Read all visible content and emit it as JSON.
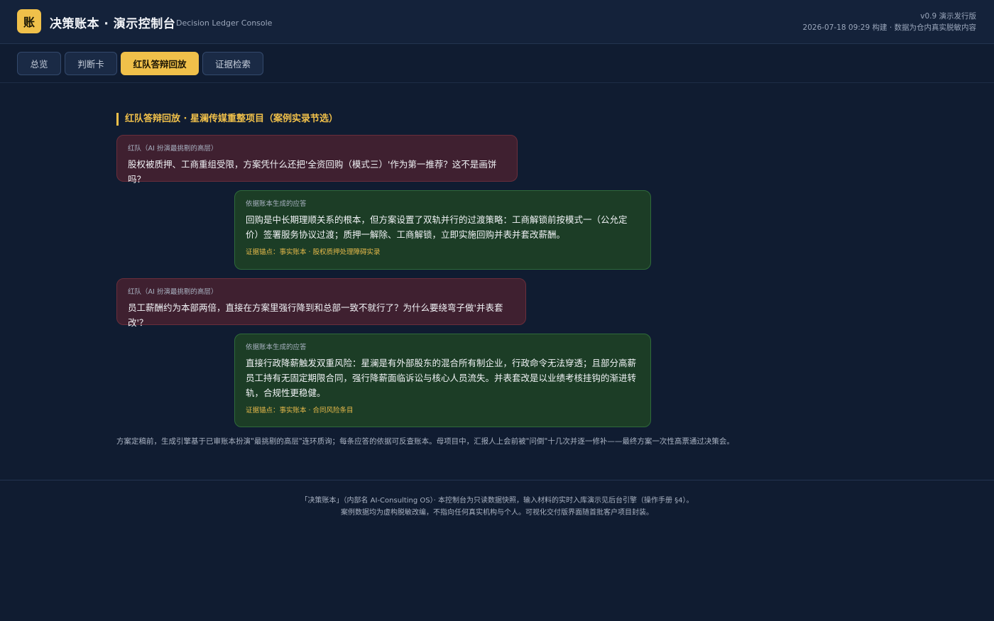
{
  "header": {
    "logo_char": "账",
    "title": "决策账本 · 演示控制台",
    "subtitle": "Decision Ledger Console",
    "version": "v0.9 演示发行版",
    "build_info": "2026-07-18 09:29 构建 · 数据为仓内真实脱敏内容"
  },
  "tabs": [
    {
      "label": "总览",
      "active": false
    },
    {
      "label": "判断卡",
      "active": false
    },
    {
      "label": "红队答辩回放",
      "active": true
    },
    {
      "label": "证据检索",
      "active": false
    }
  ],
  "section": {
    "title": "红队答辩回放 · 星澜传媒重整项目（案例实录节选）"
  },
  "messages": [
    {
      "role": "red",
      "speaker": "红队（AI 扮演最挑剔的高层）",
      "text": "股权被质押、工商重组受限，方案凭什么还把'全资回购（模式三）'作为第一推荐？这不是画饼吗？"
    },
    {
      "role": "answer",
      "speaker": "依据账本生成的应答",
      "text": "回购是中长期理顺关系的根本，但方案设置了双轨并行的过渡策略：工商解锁前按模式一（公允定价）签署服务协议过渡；质押一解除、工商解锁，立即实施回购并表并套改薪酬。",
      "anchor": "证据锚点：事实账本 · 股权质押处理障碍实录"
    },
    {
      "role": "red",
      "speaker": "红队（AI 扮演最挑剔的高层）",
      "text": "员工薪酬约为本部两倍，直接在方案里强行降到和总部一致不就行了？为什么要绕弯子做'并表套改'？"
    },
    {
      "role": "answer",
      "speaker": "依据账本生成的应答",
      "text": "直接行政降薪触发双重风险：星澜是有外部股东的混合所有制企业，行政命令无法穿透；且部分高薪员工持有无固定期限合同，强行降薪面临诉讼与核心人员流失。并表套改是以业绩考核挂钩的渐进转轨，合规性更稳健。",
      "anchor": "证据锚点：事实账本 · 合同风险条目"
    }
  ],
  "note": "方案定稿前，生成引擎基于已审账本扮演\"最挑剔的高层\"连环质询；每条应答的依据可反查账本。母项目中，汇报人上会前被\"问倒\"十几次并逐一修补——最终方案一次性高票通过决策会。",
  "footer": {
    "line1": "「决策账本」（内部名 AI-Consulting OS）· 本控制台为只读数据快照，输入材料的实时入库演示见后台引擎（操作手册 §4）。",
    "line2": "案例数据均为虚构脱敏改编，不指向任何真实机构与个人。可视化交付版界面随首批客户项目封装。"
  }
}
